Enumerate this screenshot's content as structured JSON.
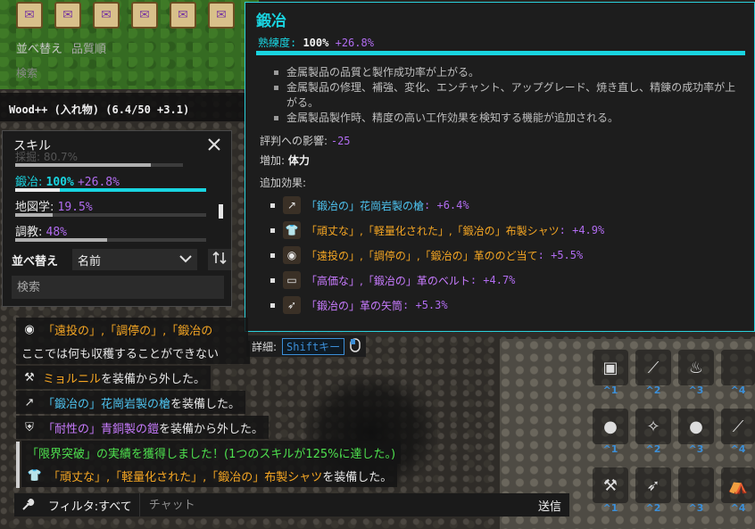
{
  "top": {
    "sort_label": "並べ替え",
    "sort_value": "品質順",
    "search_label": "検索",
    "held_item": "Wood++ (入れ物) (6.4/50 +3.1)"
  },
  "skills_panel": {
    "title": "スキル",
    "partial_text": "採掘: 80.7%",
    "skills": [
      {
        "name": "鍛冶",
        "value": "100%",
        "bonus": "+26.8%",
        "level": 1.0,
        "active": true
      },
      {
        "name": "地図学",
        "value": "19.5%",
        "level": 0.195,
        "active": false
      },
      {
        "name": "調教",
        "value": "48%",
        "level": 0.48,
        "active": false
      }
    ],
    "sort_label": "並べ替え",
    "sort_select": "名前",
    "search_placeholder": "検索"
  },
  "tooltip": {
    "title": "鍛冶",
    "proficiency_label": "熟練度: ",
    "proficiency_value": "100%",
    "proficiency_bonus": "+26.8%",
    "effects": [
      "金属製品の品質と製作成功率が上がる。",
      "金属製品の修理、補強、変化、エンチャント、アップグレード、焼き直し、精錬の成功率が上がる。",
      "金属製品製作時、精度の高い工作効果を検知する機能が追加される。"
    ],
    "reputation_label": "評判への影響: ",
    "reputation_value": "-25",
    "added_label": "増加: ",
    "added_value": "体力",
    "extra_label": "追加効果:",
    "extra_effects": [
      {
        "prefix": "「鍛冶の」花崗岩製の槍",
        "bonus": ": +6.4%",
        "color": "blue",
        "icon": "spear-icon"
      },
      {
        "prefix": "「頑丈な」,「軽量化された」,「鍛冶の」布製シャツ",
        "bonus": ": +4.9%",
        "color": "orange",
        "icon": "shirt-icon"
      },
      {
        "prefix": "「遠投の」,「調停の」,「鍛冶の」革ののど当て",
        "bonus": ": +5.5%",
        "color": "orange",
        "icon": "gorget-icon"
      },
      {
        "prefix": "「高価な」,「鍛冶の」革のベルト",
        "bonus": ": +4.7%",
        "color": "purple",
        "icon": "belt-icon"
      },
      {
        "prefix": "「鍛冶の」革の矢筒",
        "bonus": ": +5.3%",
        "color": "purple",
        "icon": "quiver-icon"
      }
    ]
  },
  "detail_hint": {
    "label": "詳細:",
    "key": "Shiftキー"
  },
  "chat": {
    "lines": [
      {
        "text": "「遠投の」,「調停の」,「鍛冶の",
        "color": "orange",
        "icon": "gorget-icon"
      },
      {
        "text": "ここでは何も収穫することができない",
        "color": "white",
        "icon": ""
      },
      {
        "text": "ミョルニルを装備から外した。",
        "color": "orange-mixed",
        "highlight": "ミョルニル",
        "rest": "を装備から外した。",
        "icon": "hammer-icon"
      },
      {
        "text": "「鍛冶の」花崗岩製の槍を装備した。",
        "color": "blue-mixed",
        "highlight": "「鍛冶の」花崗岩製の槍",
        "rest": "を装備した。",
        "icon": "spear-icon"
      },
      {
        "text": "「耐性の」青銅製の鎧を装備から外した。",
        "color": "purple-mixed",
        "highlight": "「耐性の」青銅製の鎧",
        "rest": "を装備から外した。",
        "icon": "armor-icon"
      },
      {
        "text": "「限界突破」の実績を獲得しました！(1つのスキルが125%に達した。)",
        "color": "green",
        "icon": ""
      },
      {
        "text": "「頑丈な」,「軽量化された」,「鍛冶の」布製シャツを装備した。",
        "color": "orange-mixed",
        "highlight": "「頑丈な」,「軽量化された」,「鍛冶の」布製シャツ",
        "rest": "を装備した。",
        "icon": "shirt-icon"
      }
    ],
    "filter": "フィルタ:すべて",
    "input_placeholder": "チャット",
    "send": "送信"
  },
  "hotbar": {
    "rows": [
      {
        "keys": [
          "^1",
          "^2",
          "^3",
          "^4"
        ],
        "icons": [
          "chest-icon",
          "torch-icon",
          "campfire-icon",
          ""
        ]
      },
      {
        "keys": [
          "^1",
          "^2",
          "^3",
          "^4"
        ],
        "icons": [
          "bomb-icon",
          "sparkle-icon",
          "bomb-icon",
          "pick-icon"
        ]
      },
      {
        "keys": [
          "^1",
          "^2",
          "^3",
          "^4"
        ],
        "icons": [
          "hammer-icon",
          "quiver-icon",
          "",
          "tent-icon"
        ]
      }
    ]
  },
  "colors": {
    "accent": "#19d4e0",
    "purple": "#b16cf0",
    "orange": "#f5a623",
    "blue": "#4ec3f0",
    "green": "#4ee04e"
  }
}
